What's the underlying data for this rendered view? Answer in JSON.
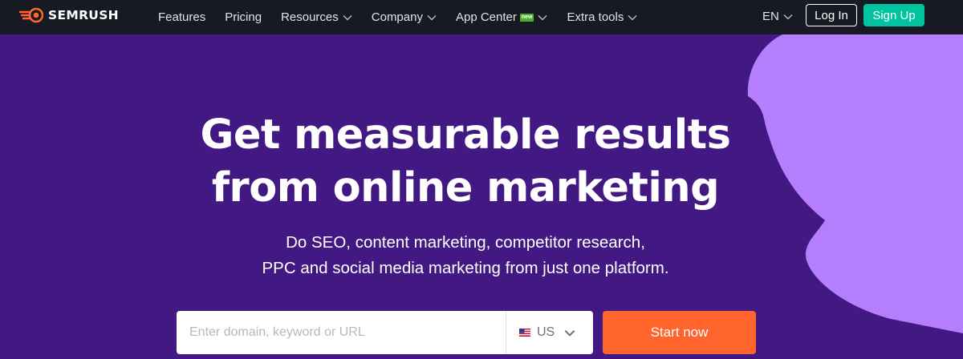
{
  "brand": {
    "name": "SEMRUSH"
  },
  "nav": {
    "items": [
      {
        "label": "Features",
        "has_dropdown": false
      },
      {
        "label": "Pricing",
        "has_dropdown": false
      },
      {
        "label": "Resources",
        "has_dropdown": true
      },
      {
        "label": "Company",
        "has_dropdown": true
      },
      {
        "label": "App Center",
        "badge": "new",
        "has_dropdown": true
      },
      {
        "label": "Extra tools",
        "has_dropdown": true
      }
    ],
    "language": "EN",
    "login_label": "Log In",
    "signup_label": "Sign Up"
  },
  "hero": {
    "headline_line1": "Get measurable results",
    "headline_line2": "from online marketing",
    "sub_line1": "Do SEO, content marketing, competitor research,",
    "sub_line2": "PPC and social media marketing from just one platform."
  },
  "search": {
    "placeholder": "Enter domain, keyword or URL",
    "value": "",
    "country": "US",
    "start_label": "Start now"
  },
  "colors": {
    "nav_bg": "#171a22",
    "hero_bg": "#421983",
    "accent_purple": "#b47efc",
    "signup_green": "#00c4a0",
    "start_orange": "#ff642d",
    "logo_orange": "#ff642d"
  },
  "icons": {
    "logo": "semrush-fireball-icon",
    "dropdown": "chevron-down-icon",
    "flag": "us-flag-icon"
  }
}
